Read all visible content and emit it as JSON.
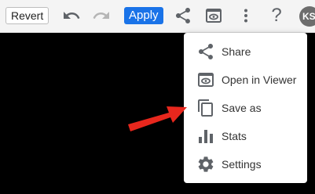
{
  "toolbar": {
    "revert_label": "Revert",
    "apply_label": "Apply",
    "help_label": "?",
    "avatar_initials": "KS",
    "icons": [
      "undo-icon",
      "redo-icon",
      "share-icon",
      "viewer-icon",
      "more-vert-icon"
    ]
  },
  "menu": {
    "items": [
      {
        "label": "Share",
        "icon": "share-icon"
      },
      {
        "label": "Open in Viewer",
        "icon": "viewer-icon"
      },
      {
        "label": "Save as",
        "icon": "copy-icon"
      },
      {
        "label": "Stats",
        "icon": "bar-chart-icon"
      },
      {
        "label": "Settings",
        "icon": "gear-icon"
      }
    ]
  },
  "colors": {
    "toolbar_bg": "#f4f4f4",
    "apply_bg": "#1a73e8",
    "icon_gray": "#5f6368",
    "icon_disabled": "#b5b5b5",
    "canvas_bg": "#000000",
    "annotation_arrow": "#e8271d"
  }
}
